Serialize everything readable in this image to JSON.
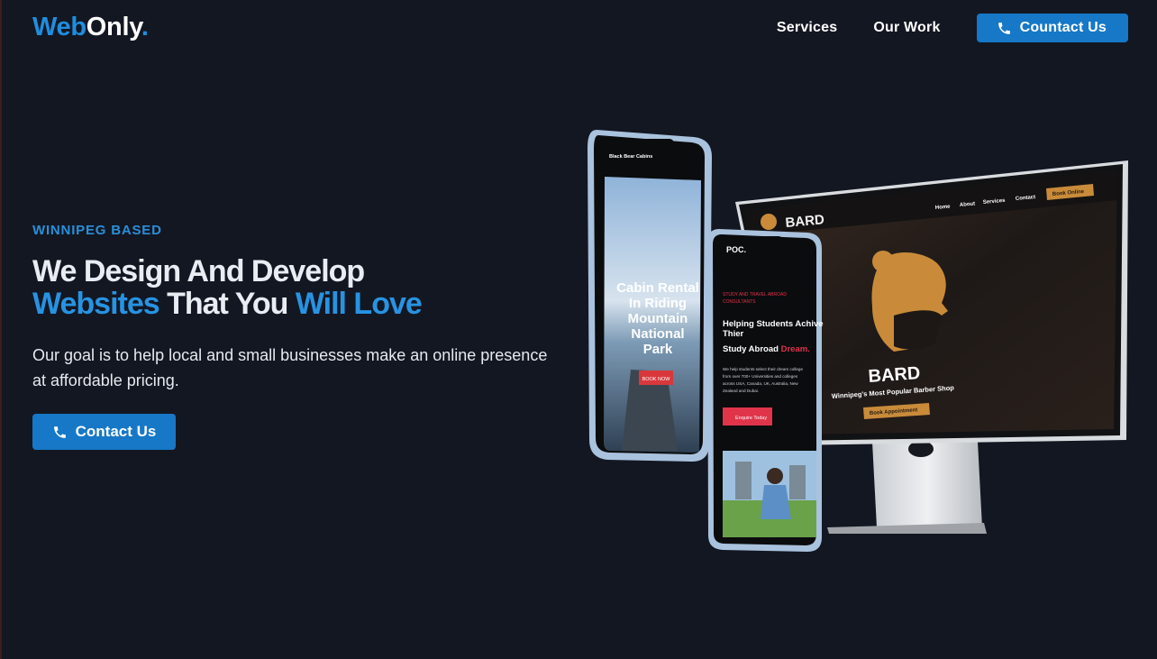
{
  "header": {
    "logo": {
      "part1": "Web",
      "part2": "Only",
      "dot": "."
    },
    "nav": [
      {
        "label": "Services"
      },
      {
        "label": "Our Work"
      }
    ],
    "contact_button": {
      "label": "Countact Us",
      "icon": "phone-icon"
    }
  },
  "hero": {
    "eyebrow": "WINNIPEG BASED",
    "headline_line1": "We Design And Develop",
    "headline_line2": {
      "a": "Websites",
      "b": " That You ",
      "c": "Will Love"
    },
    "lead": "Our goal is to help local and small businesses make an online presence at affordable pricing.",
    "cta": {
      "label": "Contact Us",
      "icon": "phone-icon"
    }
  },
  "mockups": {
    "phone1": {
      "brand": "Black Bear Cabins",
      "heading": [
        "Cabin Rental",
        "In Riding",
        "Mountain",
        "National",
        "Park"
      ],
      "button": "BOOK NOW"
    },
    "phone2": {
      "brand": "POC.",
      "eyebrow": [
        "STUDY AND TRAVEL ABROAD",
        "CONSULTANTS"
      ],
      "heading": [
        "Helping Students Achive",
        "Thier",
        "Study Abroad"
      ],
      "heading_accent": "Dream.",
      "body": [
        "We help students select their dream college",
        "from over 700+ Universities and colleges",
        "across USA, Canada, UK, Australia, New",
        "Zealand and Dubai."
      ],
      "button": "Enquire Today"
    },
    "monitor": {
      "brand": "BARD",
      "nav": [
        "Home",
        "About",
        "Services",
        "Contact"
      ],
      "nav_button": "Book Online",
      "hero_brand": "BARD",
      "tagline": "Winnipeg's Most Popular Barber Shop",
      "button": "Book Appointment"
    }
  },
  "colors": {
    "background": "#131722",
    "accent": "#1f8ee0",
    "button": "#1678c7",
    "gold": "#c98b3a",
    "red": "#e0344b"
  }
}
